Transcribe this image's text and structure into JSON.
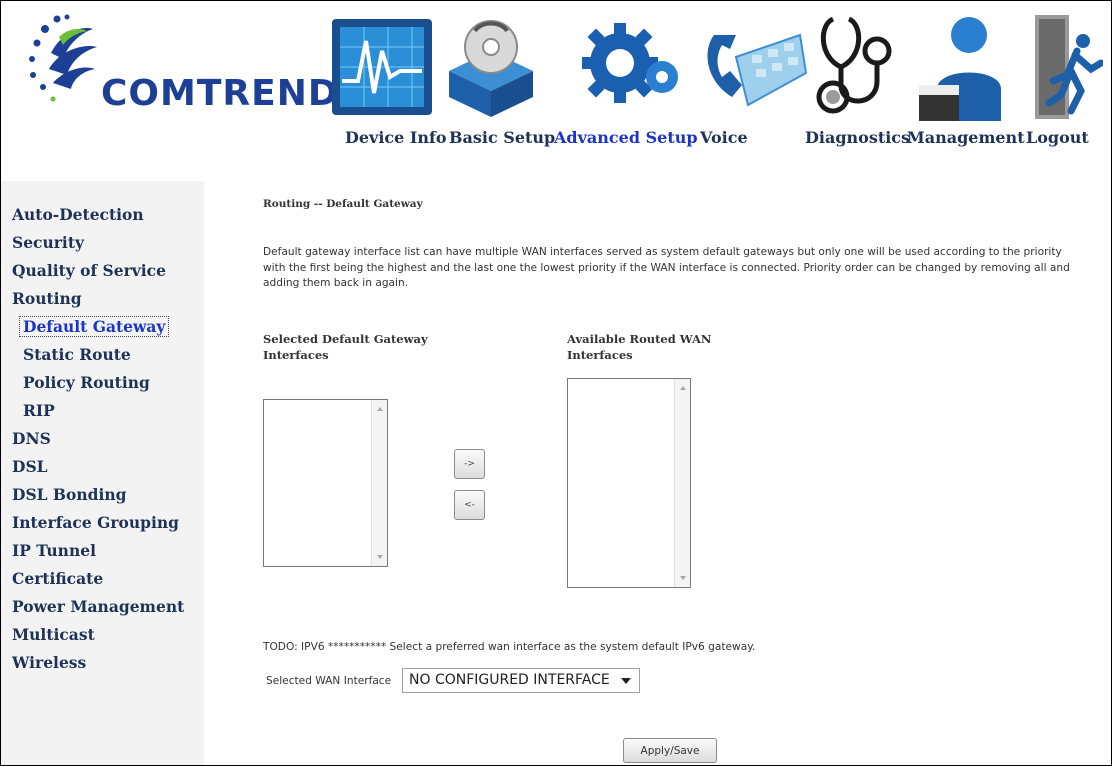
{
  "brand": {
    "name": "COMTREND",
    "color": "#1d3f96"
  },
  "nav": {
    "active_color": "#1a35c8",
    "items": [
      {
        "label": "Device Info",
        "icon": "device-info-icon"
      },
      {
        "label": "Basic Setup",
        "icon": "basic-setup-icon"
      },
      {
        "label": "Advanced Setup",
        "icon": "advanced-setup-icon",
        "active": true
      },
      {
        "label": "Voice",
        "icon": "voice-icon"
      },
      {
        "label": "Diagnostics",
        "icon": "diagnostics-icon"
      },
      {
        "label": "Management",
        "icon": "management-icon"
      },
      {
        "label": "Logout",
        "icon": "logout-icon"
      }
    ]
  },
  "sidebar": {
    "items": [
      {
        "label": "Auto-Detection"
      },
      {
        "label": "Security"
      },
      {
        "label": "Quality of Service"
      },
      {
        "label": "Routing"
      },
      {
        "label": "Default Gateway",
        "sub": true,
        "active": true
      },
      {
        "label": "Static Route",
        "sub": true
      },
      {
        "label": "Policy Routing",
        "sub": true
      },
      {
        "label": "RIP",
        "sub": true
      },
      {
        "label": "DNS"
      },
      {
        "label": "DSL"
      },
      {
        "label": "DSL Bonding"
      },
      {
        "label": "Interface Grouping"
      },
      {
        "label": "IP Tunnel"
      },
      {
        "label": "Certificate"
      },
      {
        "label": "Power Management"
      },
      {
        "label": "Multicast"
      },
      {
        "label": "Wireless"
      }
    ]
  },
  "main": {
    "title": "Routing -- Default Gateway",
    "description": "Default gateway interface list can have multiple WAN interfaces served as system default gateways but only one will be used according to the priority with the first being the highest and the last one the lowest priority if the WAN interface is connected. Priority order can be changed by removing all and adding them back in again.",
    "selected_label": "Selected Default Gateway Interfaces",
    "available_label": "Available Routed WAN Interfaces",
    "move_right_label": "->",
    "move_left_label": "<-",
    "selected_items": [],
    "available_items": [],
    "todo_text": "TODO: IPV6 *********** Select a preferred wan interface as the system default IPv6 gateway.",
    "wan_select_label": "Selected WAN Interface",
    "wan_select_value": "NO CONFIGURED INTERFACE",
    "apply_label": "Apply/Save"
  }
}
